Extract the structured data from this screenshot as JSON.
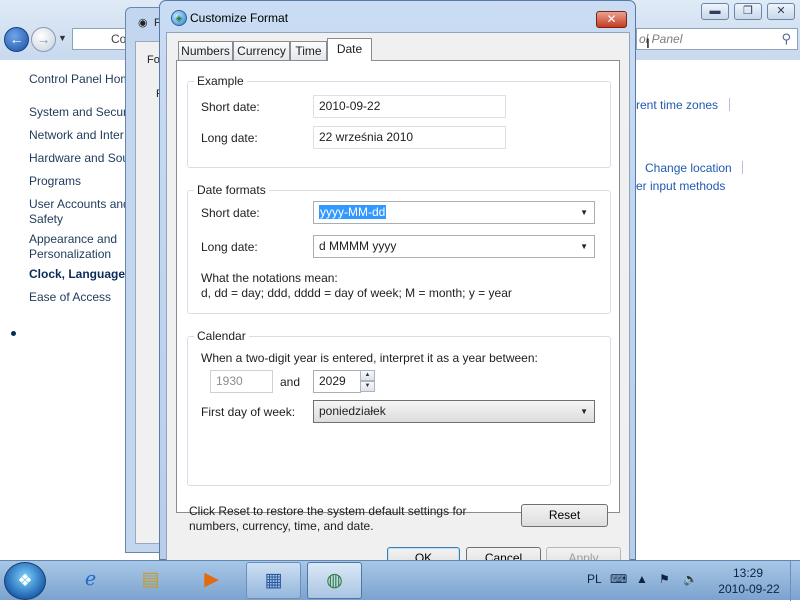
{
  "control_panel": {
    "address_text": "Co",
    "search_placeholder": "ol Panel",
    "nav": [
      {
        "label": "Control Panel Hom"
      },
      {
        "label": "System and Securi"
      },
      {
        "label": "Network and Inter"
      },
      {
        "label": "Hardware and Sou"
      },
      {
        "label": "Programs"
      },
      {
        "label": "User Accounts and"
      },
      {
        "label": "Safety"
      },
      {
        "label": "Appearance and"
      },
      {
        "label": "Personalization"
      },
      {
        "label": "Clock, Language, a"
      },
      {
        "label": "Ease of Access"
      }
    ],
    "links": {
      "time_zones": "rent time zones",
      "change_location": "Change location",
      "input_methods": "er input methods"
    },
    "win_controls": {
      "minimize": "▬",
      "maximize": "❐",
      "close": "✕"
    }
  },
  "region_dialog": {
    "title_fragment": "F",
    "tab_fragment": "Fo",
    "row_fragment": "F"
  },
  "dialog": {
    "title": "Customize Format",
    "close_glyph": "✕",
    "tabs": [
      "Numbers",
      "Currency",
      "Time",
      "Date"
    ],
    "active_tab": "Date",
    "example": {
      "group_label": "Example",
      "short_label": "Short date:",
      "short_value": "2010-09-22",
      "long_label": "Long date:",
      "long_value": "22 września 2010"
    },
    "formats": {
      "group_label": "Date formats",
      "short_label": "Short date:",
      "short_value": "yyyy-MM-dd",
      "long_label": "Long date:",
      "long_value": "d MMMM yyyy",
      "notation_title": "What the notations mean:",
      "notation_text": "d, dd = day;  ddd, dddd = day of week;  M = month;  y = year"
    },
    "calendar": {
      "group_label": "Calendar",
      "two_digit_text": "When a two-digit year is entered, interpret it as a year between:",
      "from_year": "1930",
      "and_text": "and",
      "to_year": "2029",
      "first_day_label": "First day of week:",
      "first_day_value": "poniedziałek"
    },
    "reset_text": "Click Reset to restore the system default settings for numbers, currency, time, and date.",
    "reset_button": "Reset",
    "ok_button": "OK",
    "cancel_button": "Cancel",
    "apply_button": "Apply"
  },
  "taskbar": {
    "start_glyph": "❖",
    "items": [
      {
        "name": "internet-explorer",
        "glyph": "ℯ",
        "state": "normal"
      },
      {
        "name": "windows-explorer",
        "glyph": "▤",
        "state": "normal"
      },
      {
        "name": "media-player",
        "glyph": "▶",
        "state": "normal"
      },
      {
        "name": "control-panel",
        "glyph": "▦",
        "state": "open"
      },
      {
        "name": "region-language",
        "glyph": "◍",
        "state": "active"
      }
    ],
    "language": "PL",
    "time": "13:29",
    "date": "2010-09-22"
  },
  "colors": {
    "accent": "#3399ff",
    "link": "#1f5ab0",
    "close_red": "#c63b22",
    "taskbar": "#7ba3cf"
  }
}
